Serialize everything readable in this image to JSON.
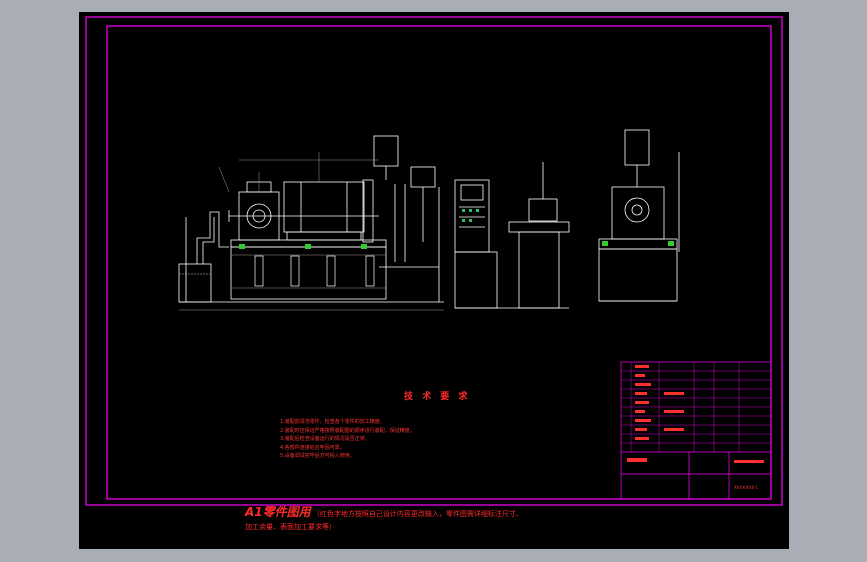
{
  "technical_requirements": {
    "title": "技 术 要 求",
    "items": [
      "1.装配前清洗零件，检查各个零件的加工精度。",
      "2.装配时应保证严格按照装配图的顺序进行装配，保证精度。",
      "3.装配后检查设备运行的情况是否正常。",
      "4.各部件连接处应牢固可靠。",
      "5.设备调试完毕后方可投入使用。"
    ]
  },
  "footer": {
    "big_label": "A1零件图用",
    "line1": "（红色字地方按照自己设计内容更改输入，零件图需详细标注尺寸、",
    "line2": "加工余量、表面加工要求等）"
  },
  "title_block": {
    "drawing_number": "XXXX-XXX-1"
  },
  "colors": {
    "background": "#000000",
    "border": "#ff00ff",
    "outline": "#ffffff",
    "annotation": "#ff3333",
    "dimension": "#cccccc",
    "chrome": "#a9aeb6"
  }
}
